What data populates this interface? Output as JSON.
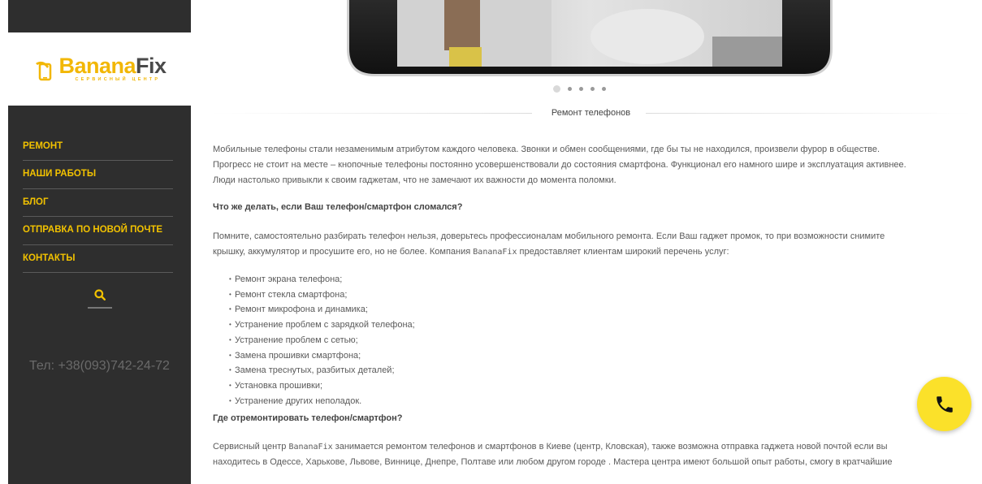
{
  "logo": {
    "name_part1": "Banana",
    "name_part2": "Fix",
    "subtitle": "СЕРВИСНЫЙ ЦЕНТР"
  },
  "nav": {
    "items": [
      {
        "label": "РЕМОНТ"
      },
      {
        "label": "НАШИ РАБОТЫ"
      },
      {
        "label": "БЛОГ"
      },
      {
        "label": "ОТПРАВКА ПО НОВОЙ ПОЧТЕ"
      },
      {
        "label": "КОНТАКТЫ"
      }
    ]
  },
  "sidebar": {
    "phone": "Тел: +38(093)742-24-72"
  },
  "slider": {
    "total": 5,
    "active": 1
  },
  "section": {
    "title": "Ремонт телефонов"
  },
  "article": {
    "intro_l1": "Мобильные телефоны стали незаменимым атрибутом каждого человека. Звонки и обмен сообщениями, где бы ты не находился, произвели фурор в обществе.",
    "intro_l2": "Прогресс не стоит на месте – кнопочные телефоны постоянно усовершенствовали до состояния смартфона. Функционал его намного шире и эксплуатация активнее.",
    "intro_l3": "Люди настолько привыкли к своим гаджетам, что не замечают их важности до момента поломки.",
    "q1": "Что же делать, если Ваш телефон/смартфон сломался?",
    "p2_l1": "Помните, самостоятельно разбирать телефон нельзя, доверьтесь профессионалам мобильного ремонта. Если Ваш гаджет промок, то при возможности снимите",
    "p2_l2_a": "крышку, аккумулятор и просушите его, но не более.  Компания ",
    "p2_brand": "BananaFix",
    "p2_l2_b": " предоставляет клиентам широкий перечень услуг:",
    "services": [
      "Ремонт экрана телефона;",
      "Ремонт стекла смартфона;",
      "Ремонт микрофона и динамика;",
      "Устранение проблем с зарядкой телефона;",
      "Устранение проблем с сетью;",
      "Замена прошивки смартфона;",
      "Замена треснутых, разбитых деталей;",
      "Установка прошивки;",
      "Устранение других неполадок."
    ],
    "q2": "Где отремонтировать телефон/смартфон?",
    "p3_l1_a": "Сервисный центр ",
    "p3_brand": "BananaFix",
    "p3_l1_b": " занимается ремонтом телефонов и смартфонов в Киеве (центр, Кловская), также возможна отправка гаджета новой почтой если вы",
    "p3_l2": "находитесь в Одессе, Харькове, Львове, Виннице, Днепре, Полтаве или любом другом городе  . Мастера центра имеют большой опыт работы, смогу в кратчайшие"
  },
  "colors": {
    "sidebar_bg": "#2e2e2e",
    "accent_yellow": "#f2c200",
    "call_button": "#fbe12a"
  },
  "icons": {
    "search": "search-icon",
    "phone": "phone-icon"
  }
}
